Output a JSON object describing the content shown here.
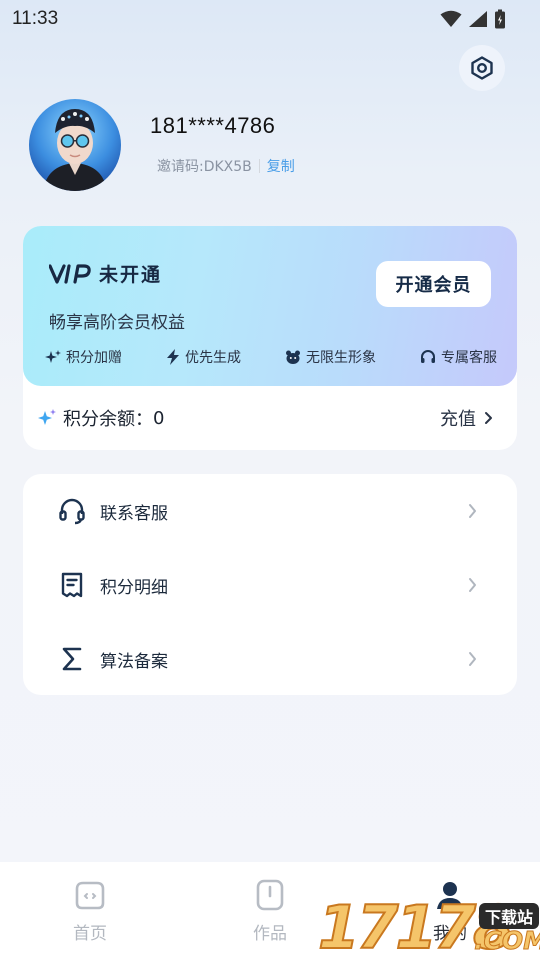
{
  "status_bar": {
    "time": "11:33"
  },
  "profile": {
    "phone": "181****4786",
    "invite_label": "邀请码:DKX5B",
    "copy_label": "复制"
  },
  "vip": {
    "badge_text": "VIP",
    "status": "未开通",
    "open_button": "开通会员",
    "description": "畅享高阶会员权益",
    "benefits": [
      {
        "icon": "sparkle-icon",
        "label": "积分加赠"
      },
      {
        "icon": "lightning-icon",
        "label": "优先生成"
      },
      {
        "icon": "bear-face-icon",
        "label": "无限生形象"
      },
      {
        "icon": "headset-icon",
        "label": "专属客服"
      }
    ]
  },
  "points": {
    "label": "积分余额：",
    "value": "0",
    "recharge_label": "充值"
  },
  "menu": {
    "items": [
      {
        "icon": "headset-icon",
        "label": "联系客服"
      },
      {
        "icon": "receipt-icon",
        "label": "积分明细"
      },
      {
        "icon": "sigma-icon",
        "label": "算法备案"
      }
    ]
  },
  "tabs": [
    {
      "icon": "home-icon",
      "label": "首页",
      "active": false
    },
    {
      "icon": "works-icon",
      "label": "作品",
      "active": false
    },
    {
      "icon": "profile-icon",
      "label": "我的",
      "active": true
    }
  ],
  "watermark": {
    "number": "17178",
    "badge": "下载站",
    "domain": ".COM"
  },
  "colors": {
    "accent_link": "#4a9ee8",
    "vip_gradient_start": "#a9ecfa",
    "vip_gradient_end": "#c5c9fb",
    "text_dark": "#172843"
  }
}
